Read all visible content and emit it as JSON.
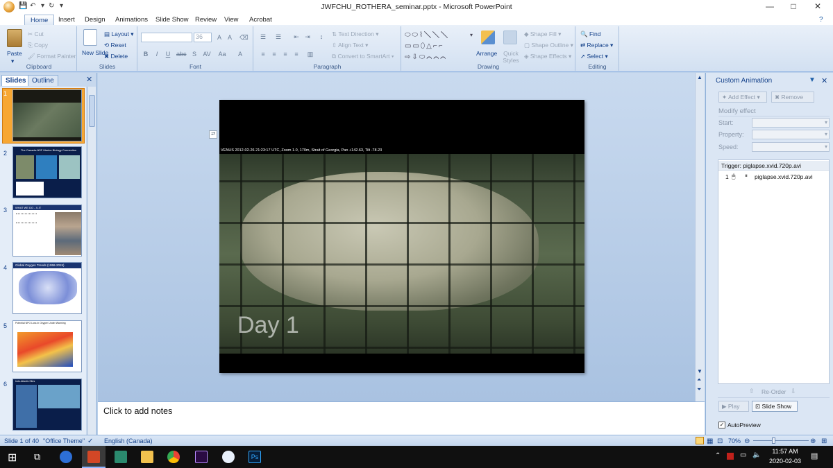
{
  "window": {
    "title": "JWFCHU_ROTHERA_seminar.pptx - Microsoft PowerPoint",
    "minimize_glyph": "—",
    "maximize_glyph": "□",
    "close_glyph": "✕"
  },
  "ribbon_tabs": [
    "Home",
    "Insert",
    "Design",
    "Animations",
    "Slide Show",
    "Review",
    "View",
    "Acrobat"
  ],
  "ribbon": {
    "clipboard": {
      "label": "Clipboard",
      "paste": "Paste",
      "cut": "Cut",
      "copy": "Copy",
      "format_painter": "Format Painter"
    },
    "slides": {
      "label": "Slides",
      "new_slide": "New Slide",
      "layout": "Layout",
      "reset": "Reset",
      "delete": "Delete"
    },
    "font": {
      "label": "Font",
      "size": "36"
    },
    "paragraph": {
      "label": "Paragraph",
      "text_direction": "Text Direction",
      "align_text": "Align Text",
      "convert_smartart": "Convert to SmartArt"
    },
    "drawing": {
      "label": "Drawing",
      "arrange": "Arrange",
      "quick_styles": "Quick Styles",
      "shape_fill": "Shape Fill",
      "shape_outline": "Shape Outline",
      "shape_effects": "Shape Effects"
    },
    "editing": {
      "label": "Editing",
      "find": "Find",
      "replace": "Replace",
      "select": "Select"
    }
  },
  "slides_panel": {
    "tab_slides": "Slides",
    "tab_outline": "Outline",
    "numbers": [
      "1",
      "2",
      "3",
      "4",
      "5",
      "6"
    ],
    "thumb_titles": [
      "",
      "The Canada-NSF Marine Biology Connection",
      "WHAT WE DO - X-IT",
      "Global Oxygen Trends (1958-2015)",
      "Potential NPO Loss in Oxygen Under Warming",
      "Indo-Atlantic Sites"
    ]
  },
  "slide": {
    "caption": "VENUS 2012-02-26 21:23:17 UTC, Zoom 1.0, 170m, Strait of Georgia, Pan +142.63, Tilt -78.23",
    "overlay_text": "Day 1"
  },
  "notes": {
    "placeholder": "Click to add notes"
  },
  "custom_animation": {
    "title": "Custom Animation",
    "add_effect": "Add Effect",
    "remove": "Remove",
    "modify_effect": "Modify effect",
    "start": "Start:",
    "property": "Property:",
    "speed": "Speed:",
    "trigger": "Trigger: piglapse.xvid.720p.avi",
    "item_number": "1",
    "item_name": "piglapse.xvid.720p.avi",
    "reorder": "Re-Order",
    "play": "Play",
    "slide_show": "Slide Show",
    "autopreview": "AutoPreview"
  },
  "status": {
    "slide_of": "Slide 1 of 40",
    "theme": "\"Office Theme\"",
    "language": "English (Canada)",
    "zoom": "70%"
  },
  "taskbar": {
    "time": "11:57 AM",
    "date": "2020-02-03"
  },
  "colors": {
    "accent": "#15428b",
    "ribbon_bg": "#dbe7f6",
    "selected_thumb": "#f5a623"
  }
}
